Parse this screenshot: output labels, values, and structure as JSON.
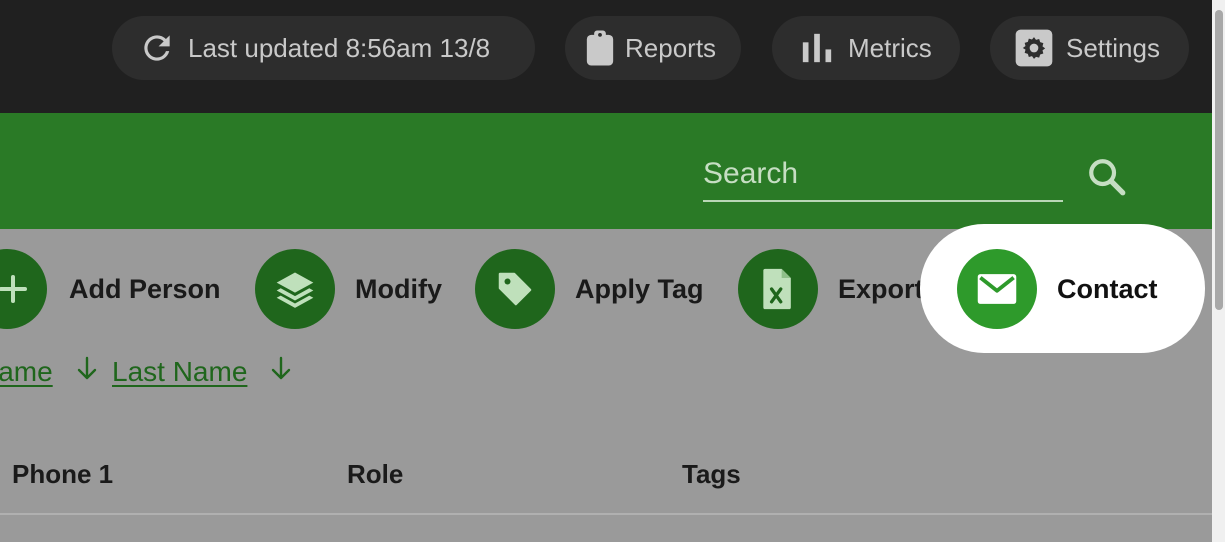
{
  "topbar": {
    "last_updated": "Last updated 8:56am 13/8",
    "reports": "Reports",
    "metrics": "Metrics",
    "settings": "Settings"
  },
  "search": {
    "placeholder": "Search"
  },
  "actions": {
    "add_person": "Add Person",
    "modify": "Modify",
    "apply_tag": "Apply Tag",
    "export": "Export",
    "contact": "Contact"
  },
  "sort": {
    "first_name_visible": "lame",
    "last_name": "Last Name"
  },
  "table": {
    "headers": [
      "Phone 1",
      "Role",
      "Tags"
    ]
  },
  "colors": {
    "topbar": "#202020",
    "green_band": "#2a7a26",
    "action_circle": "#1f661c",
    "highlight_circle": "#2e9a2b"
  }
}
